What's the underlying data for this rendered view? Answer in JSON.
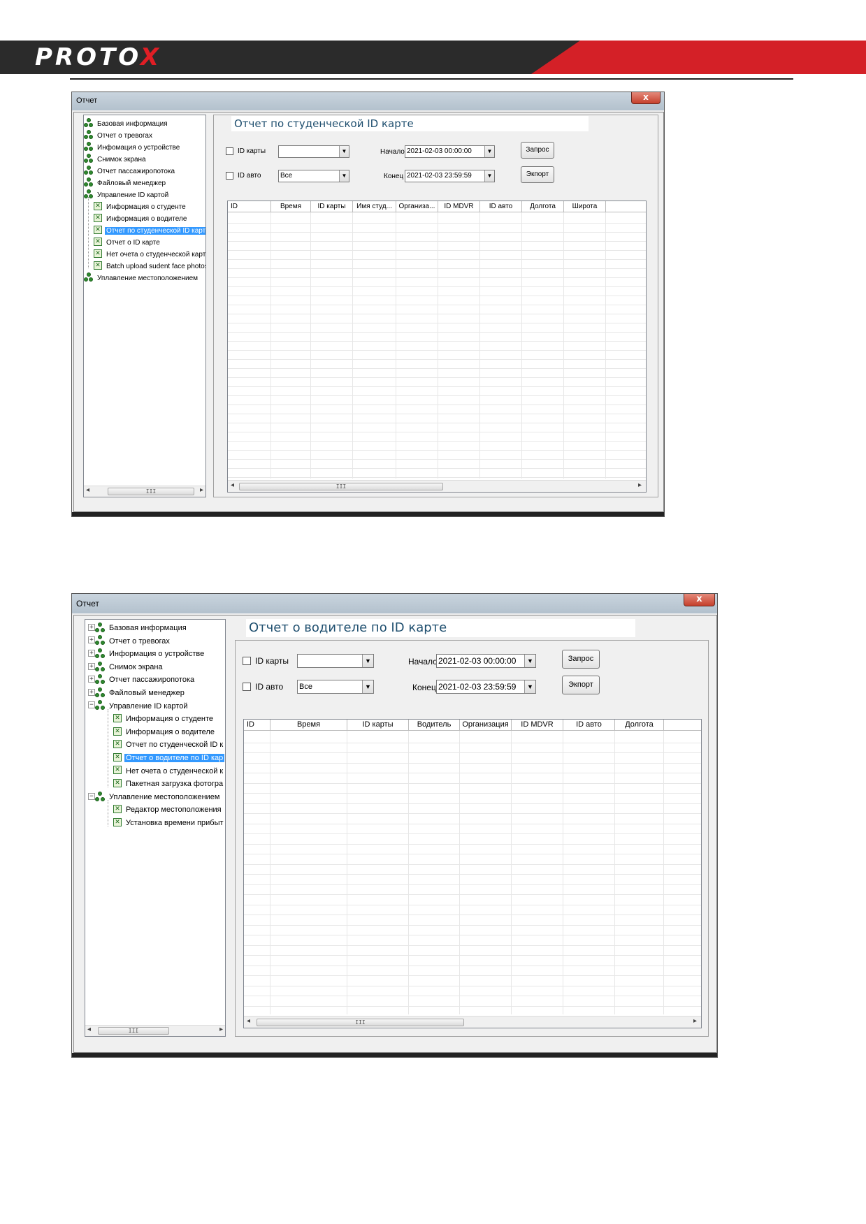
{
  "brand": {
    "logo_text": "PROTO",
    "logo_accent": "X",
    "red": "#d42027",
    "dark": "#2b2b2b"
  },
  "window1": {
    "title": "Отчет",
    "close": "x",
    "heading": "Отчет по студенческой ID карте",
    "tree": {
      "groups": [
        "Базовая информация",
        "Отчет о тревогах",
        "Инфомация о устройстве",
        "Снимок экрана",
        "Отчет пассажиропотока",
        "Файловый менеджер",
        "Управление ID картой"
      ],
      "children": [
        "Информация о студенте",
        "Информация о водителе",
        "Отчет по студенческой ID карте",
        "Отчет о ID карте",
        "Нет очета о студенческой карте",
        "Batch upload sudent face photos"
      ],
      "last_group": "Уплавление местоположением",
      "selected_index": 2,
      "scroll_thumb": "III"
    },
    "form": {
      "id_card_label": "ID карты",
      "id_card_value": "",
      "id_auto_label": "ID авто",
      "id_auto_value": "Все",
      "start_label": "Начало",
      "start_value": "2021-02-03 00:00:00",
      "end_label": "Конец",
      "end_value": "2021-02-03 23:59:59",
      "query_button": "Запрос",
      "export_button": "Экпорт"
    },
    "table": {
      "columns": [
        "ID",
        "Время",
        "ID карты",
        "Имя студ...",
        "Организа...",
        "ID MDVR",
        "ID авто",
        "Долгота",
        "Широта"
      ],
      "scroll_thumb": "III"
    }
  },
  "window2": {
    "title": "Отчет",
    "close": "x",
    "heading": "Отчет о водителе по ID карте",
    "tree": {
      "groups": [
        "Базовая информация",
        "Отчет о тревогах",
        "Информация о устройстве",
        "Снимок экрана",
        "Отчет пассажиропотока",
        "Файловый менеджер",
        "Управление ID картой"
      ],
      "children": [
        "Информация о студенте",
        "Информация о водителе",
        "Отчет по студенческой ID к",
        "Отчет о водителе по ID кар",
        "Нет очета о студенческой к",
        "Пакетная загрузка фотогра"
      ],
      "last_group": "Уплавление местоположением",
      "last_children": [
        "Редактор местоположения",
        "Установка времени прибыт"
      ],
      "selected_index": 3,
      "scroll_thumb": "III"
    },
    "form": {
      "id_card_label": "ID карты",
      "id_card_value": "",
      "id_auto_label": "ID авто",
      "id_auto_value": "Все",
      "start_label": "Начало",
      "start_value": "2021-02-03 00:00:00",
      "end_label": "Конец",
      "end_value": "2021-02-03 23:59:59",
      "query_button": "Запрос",
      "export_button": "Экпорт"
    },
    "table": {
      "columns": [
        "ID",
        "Время",
        "ID карты",
        "Водитель",
        "Организация",
        "ID MDVR",
        "ID авто",
        "Долгота"
      ],
      "scroll_thumb": "III"
    }
  }
}
